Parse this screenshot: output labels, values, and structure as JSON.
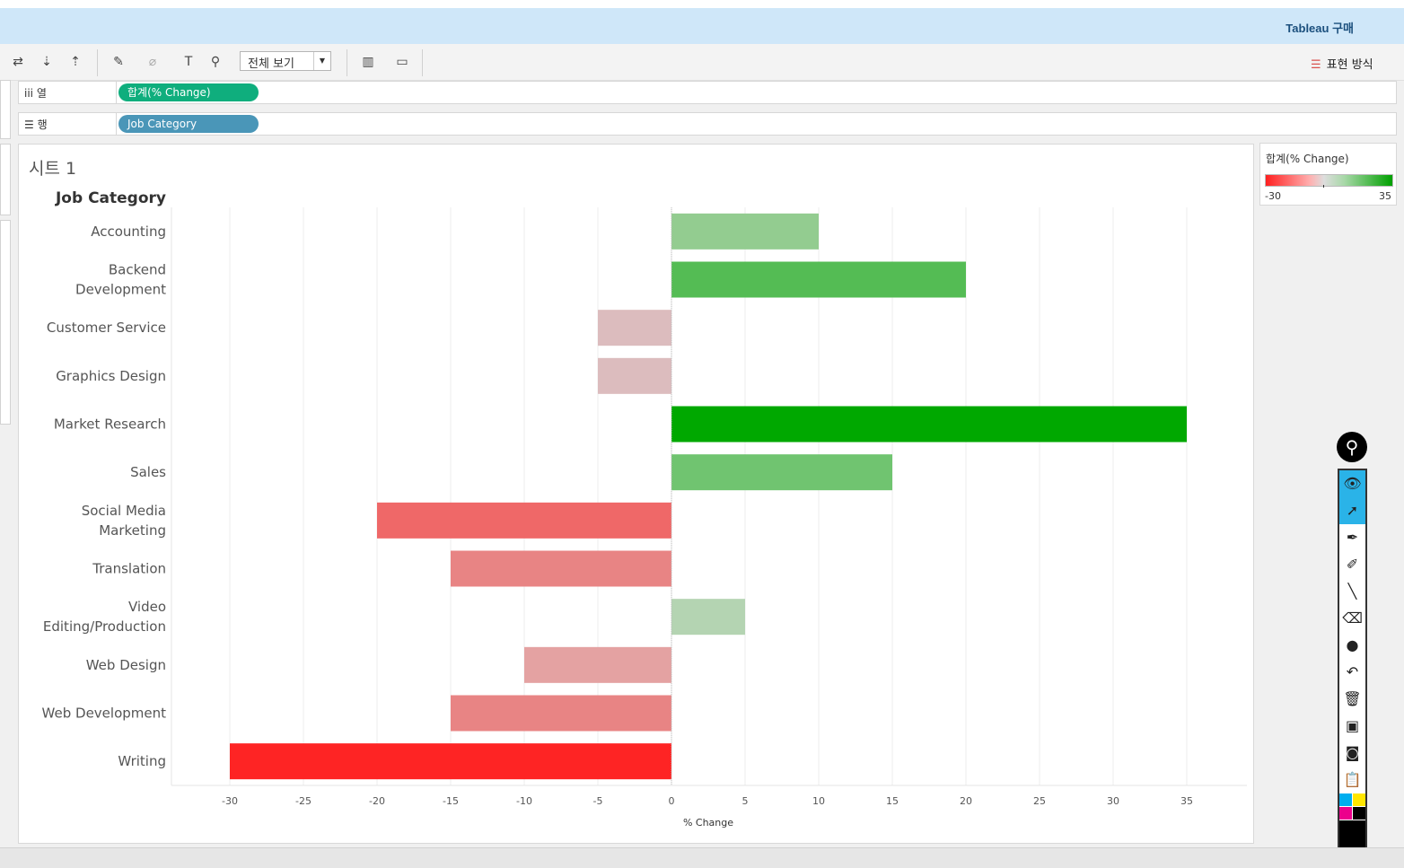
{
  "app": {
    "buy_label": "Tableau 구매"
  },
  "toolbar": {
    "fit_label": "전체 보기",
    "show_me_label": "표현 방식"
  },
  "shelves": {
    "columns": {
      "name": "iii  열",
      "pill": "합계(% Change)",
      "pill_color": "#0fae7d"
    },
    "rows": {
      "name": "☰  행",
      "pill": "Job Category",
      "pill_color": "#4a96b8"
    }
  },
  "sheet": {
    "title": "시트 1"
  },
  "legend": {
    "title": "합계(% Change)",
    "min_label": "-30",
    "max_label": "35"
  },
  "chart_data": {
    "type": "bar",
    "orientation": "horizontal",
    "row_header": "Job Category",
    "xlabel": "% Change",
    "xlim": [
      -30,
      35
    ],
    "xticks": [
      -30,
      -25,
      -20,
      -15,
      -10,
      -5,
      0,
      5,
      10,
      15,
      20,
      25,
      30,
      35
    ],
    "categories": [
      "Accounting",
      "Backend Development",
      "Customer Service",
      "Graphics Design",
      "Market Research",
      "Sales",
      "Social Media Marketing",
      "Translation",
      "Video Editing/Production",
      "Web Design",
      "Web Development",
      "Writing"
    ],
    "category_lines": [
      [
        "Accounting"
      ],
      [
        "Backend",
        "Development"
      ],
      [
        "Customer Service"
      ],
      [
        "Graphics Design"
      ],
      [
        "Market Research"
      ],
      [
        "Sales"
      ],
      [
        "Social Media",
        "Marketing"
      ],
      [
        "Translation"
      ],
      [
        "Video",
        "Editing/Production"
      ],
      [
        "Web Design"
      ],
      [
        "Web Development"
      ],
      [
        "Writing"
      ]
    ],
    "values": [
      10,
      20,
      -5,
      -5,
      35,
      15,
      -20,
      -15,
      5,
      -10,
      -15,
      -30
    ],
    "colors": [
      "#93cc90",
      "#54bc54",
      "#dcbcbe",
      "#dcbcbe",
      "#00a800",
      "#70c470",
      "#ef6868",
      "#e88484",
      "#b4d4b2",
      "#e4a2a2",
      "#e88484",
      "#fe2424"
    ],
    "grid": true
  }
}
